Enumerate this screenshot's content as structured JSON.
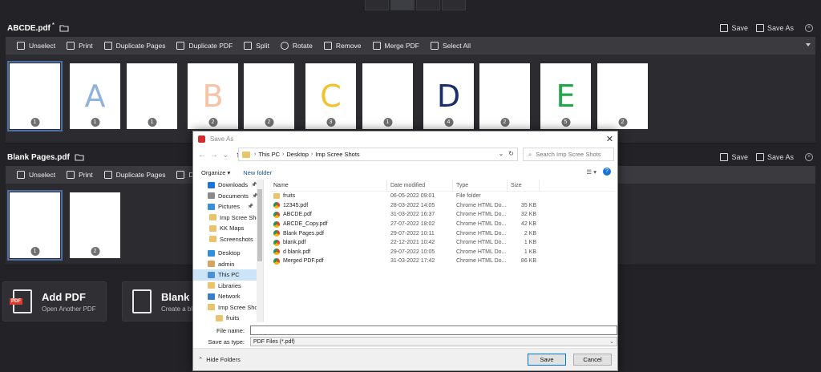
{
  "top_doc": {
    "title": "ABCDE.pdf",
    "modified_marker": "*",
    "save_label": "Save",
    "save_as_label": "Save As",
    "pages": [
      {
        "num": "1",
        "letter": "",
        "color": ""
      },
      {
        "num": "1",
        "letter": "A",
        "color": "#8fb3dd"
      },
      {
        "num": "1",
        "letter": "",
        "color": ""
      },
      {
        "num": "2",
        "letter": "B",
        "color": "#f5c3a8"
      },
      {
        "num": "2",
        "letter": "",
        "color": ""
      },
      {
        "num": "3",
        "letter": "C",
        "color": "#f2c12e"
      },
      {
        "num": "1",
        "letter": "",
        "color": ""
      },
      {
        "num": "4",
        "letter": "D",
        "color": "#1d2f6b"
      },
      {
        "num": "2",
        "letter": "",
        "color": ""
      },
      {
        "num": "5",
        "letter": "E",
        "color": "#24a64d"
      },
      {
        "num": "2",
        "letter": "",
        "color": ""
      }
    ]
  },
  "toolbar": {
    "unselect": "Unselect",
    "print": "Print",
    "duplicate_pages": "Duplicate Pages",
    "duplicate_pdf": "Duplicate PDF",
    "split": "Split",
    "rotate": "Rotate",
    "remove": "Remove",
    "merge_pdf": "Merge PDF",
    "select_all": "Select All",
    "duplicate_truncated": "Duplic"
  },
  "bottom_doc": {
    "title": "Blank Pages.pdf",
    "save_label": "Save",
    "save_as_label": "Save As",
    "pages": [
      {
        "num": "1"
      },
      {
        "num": "2"
      }
    ]
  },
  "cards": {
    "add_pdf_title": "Add PDF",
    "add_pdf_sub": "Open Another PDF",
    "pdf_badge": "PDF",
    "blank_title": "Blank P",
    "blank_sub": "Create a bla"
  },
  "dialog": {
    "title": "Save As",
    "breadcrumb": [
      "This PC",
      "Desktop",
      "Imp Scree Shots"
    ],
    "search_placeholder": "Search Imp Scree Shots",
    "organize": "Organize",
    "new_folder": "New folder",
    "nav_items": [
      {
        "label": "Downloads",
        "icon": "download-icon",
        "color": "#1a73d9",
        "pinned": true
      },
      {
        "label": "Documents",
        "icon": "documents-icon",
        "color": "#8a8a8a",
        "pinned": true
      },
      {
        "label": "Pictures",
        "icon": "pictures-icon",
        "color": "#3a8fd6",
        "pinned": true
      },
      {
        "label": "Imp Scree Shots",
        "icon": "folder-icon",
        "color": "#e9c46a",
        "pinned": false
      },
      {
        "label": "KK Maps",
        "icon": "folder-icon",
        "color": "#e9c46a",
        "pinned": false
      },
      {
        "label": "Screenshots",
        "icon": "folder-icon",
        "color": "#e9c46a",
        "pinned": false
      },
      {
        "label": "Desktop",
        "icon": "desktop-icon",
        "color": "#2f8fdc",
        "pinned": false
      },
      {
        "label": "admin",
        "icon": "user-icon",
        "color": "#d9a25f",
        "pinned": false
      },
      {
        "label": "This PC",
        "icon": "pc-icon",
        "color": "#4a90d9",
        "pinned": false
      },
      {
        "label": "Libraries",
        "icon": "libraries-icon",
        "color": "#e9c46a",
        "pinned": false
      },
      {
        "label": "Network",
        "icon": "network-icon",
        "color": "#3a7fc4",
        "pinned": false
      },
      {
        "label": "Imp Scree Shots",
        "icon": "folder-icon",
        "color": "#e9c46a",
        "pinned": false
      },
      {
        "label": "fruits",
        "icon": "folder-icon",
        "color": "#e9c46a",
        "pinned": false
      }
    ],
    "columns": {
      "name": "Name",
      "date": "Date modified",
      "type": "Type",
      "size": "Size"
    },
    "files": [
      {
        "name": "fruits",
        "date": "06-05-2022 09:01",
        "type": "File folder",
        "size": "",
        "kind": "folder"
      },
      {
        "name": "12345.pdf",
        "date": "28-03-2022 14:05",
        "type": "Chrome HTML Do...",
        "size": "35 KB",
        "kind": "pdf"
      },
      {
        "name": "ABCDE.pdf",
        "date": "31-03-2022 16:37",
        "type": "Chrome HTML Do...",
        "size": "32 KB",
        "kind": "pdf"
      },
      {
        "name": "ABCDE_Copy.pdf",
        "date": "27-07-2022 18:02",
        "type": "Chrome HTML Do...",
        "size": "42 KB",
        "kind": "pdf"
      },
      {
        "name": "Blank Pages.pdf",
        "date": "29-07-2022 10:11",
        "type": "Chrome HTML Do...",
        "size": "2 KB",
        "kind": "pdf"
      },
      {
        "name": "blank.pdf",
        "date": "22-12-2021 10:42",
        "type": "Chrome HTML Do...",
        "size": "1 KB",
        "kind": "pdf"
      },
      {
        "name": "d blank.pdf",
        "date": "29-07-2022 10:05",
        "type": "Chrome HTML Do...",
        "size": "1 KB",
        "kind": "pdf"
      },
      {
        "name": "Merged PDF.pdf",
        "date": "31-03-2022 17:42",
        "type": "Chrome HTML Do...",
        "size": "86 KB",
        "kind": "pdf"
      }
    ],
    "file_name_label": "File name:",
    "file_name_value": "",
    "save_type_label": "Save as type:",
    "save_type_value": "PDF Files (*.pdf)",
    "hide_folders": "Hide Folders",
    "save_button": "Save",
    "cancel_button": "Cancel"
  }
}
